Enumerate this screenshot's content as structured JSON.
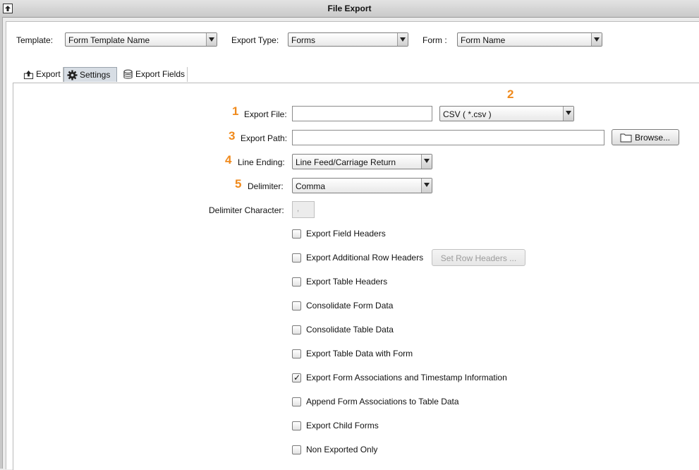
{
  "window": {
    "title": "File Export"
  },
  "header": {
    "template_label": "Template:",
    "template_value": "Form Template Name",
    "export_type_label": "Export Type:",
    "export_type_value": "Forms",
    "form_label": "Form :",
    "form_value": "Form Name"
  },
  "tabs": [
    {
      "label": "Export",
      "icon": "export-icon"
    },
    {
      "label": "Settings",
      "icon": "gear-icon",
      "active": true
    },
    {
      "label": "Export Fields",
      "icon": "database-icon"
    }
  ],
  "settings": {
    "markers": [
      "1",
      "2",
      "3",
      "4",
      "5"
    ],
    "export_file_label": "Export File:",
    "export_file_value": "",
    "file_format_value": "CSV ( *.csv )",
    "export_path_label": "Export Path:",
    "export_path_value": "",
    "browse_label": "Browse...",
    "line_ending_label": "Line Ending:",
    "line_ending_value": "Line Feed/Carriage Return",
    "delimiter_label": "Delimiter:",
    "delimiter_value": "Comma",
    "delimiter_char_label": "Delimiter Character:",
    "delimiter_char_value": ",",
    "set_row_headers_label": "Set Row Headers ..."
  },
  "options": [
    {
      "label": "Export Field Headers",
      "checked": false
    },
    {
      "label": "Export Additional Row Headers",
      "checked": false
    },
    {
      "label": "Export Table Headers",
      "checked": false
    },
    {
      "label": "Consolidate Form Data",
      "checked": false
    },
    {
      "label": "Consolidate Table Data",
      "checked": false
    },
    {
      "label": "Export Table Data with Form",
      "checked": false
    },
    {
      "label": "Export Form Associations and Timestamp Information",
      "checked": true
    },
    {
      "label": "Append Form Associations to Table Data",
      "checked": false
    },
    {
      "label": "Export Child Forms",
      "checked": false
    },
    {
      "label": "Non Exported Only",
      "checked": false
    }
  ],
  "colors": {
    "marker": "#f08a1c",
    "active_tab": "#d7dde4"
  }
}
